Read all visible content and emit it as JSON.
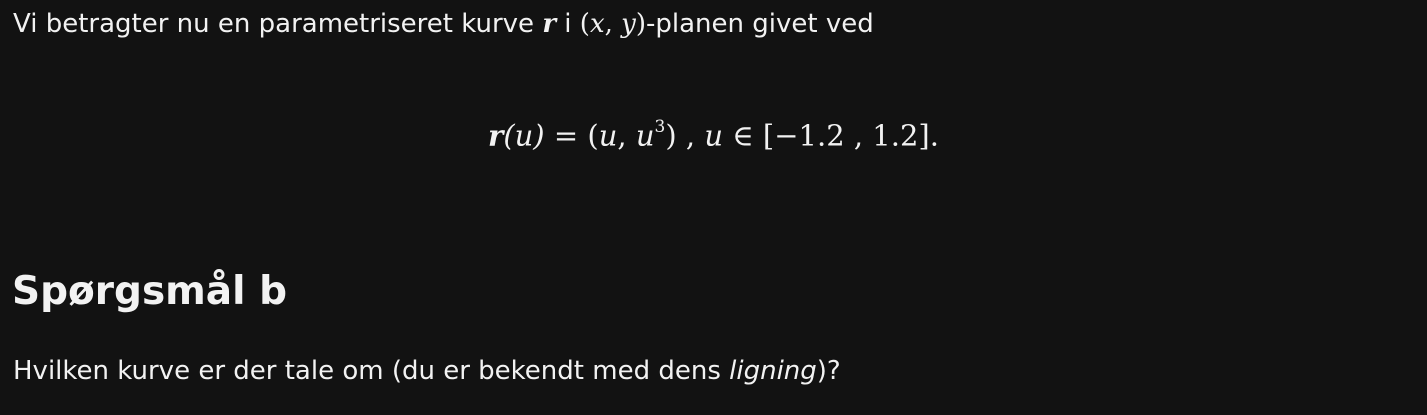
{
  "intro": {
    "text_before": "Vi betragter nu en parametriseret kurve",
    "vector_symbol": "r",
    "text_between": "i",
    "plane_open": "(",
    "plane_x": "x",
    "plane_comma": ",",
    "plane_y": "y",
    "plane_close": ")",
    "text_after": "-planen givet ved"
  },
  "equation": {
    "lhs_vector": "r",
    "lhs_arg": "(u)",
    "equals": "=",
    "open": "(",
    "u": "u",
    "comma": ",",
    "u2": "u",
    "exponent": "3",
    "close": ")",
    "sep": ",",
    "param": "u",
    "in": "∈",
    "interval": "[−1.2 , 1.2]."
  },
  "section": {
    "title": "Spørgsmål b"
  },
  "question": {
    "text_before": "Hvilken kurve er der tale om (du er bekendt med dens",
    "emphasis": "ligning",
    "text_after": ")?"
  }
}
